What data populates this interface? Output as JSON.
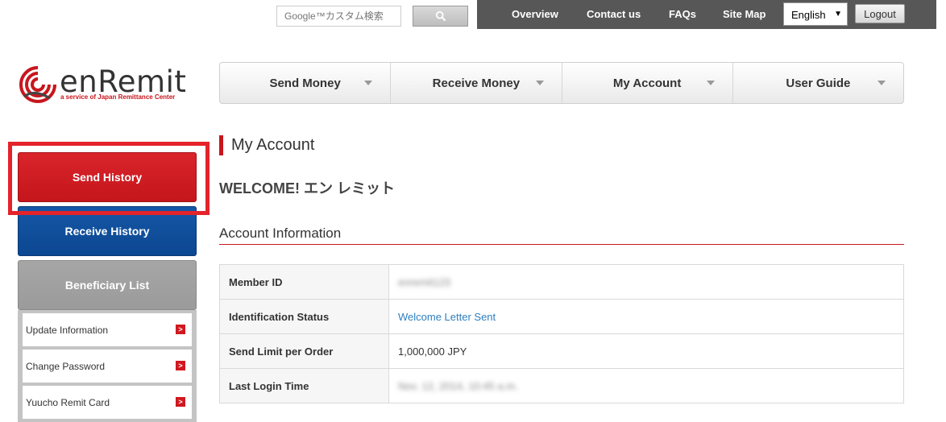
{
  "search": {
    "placeholder": "Google™カスタム検索"
  },
  "topbar": {
    "links": [
      "Overview",
      "Contact us",
      "FAQs",
      "Site Map"
    ],
    "language": "English",
    "logout_label": "Logout"
  },
  "logo": {
    "name": "enRemit",
    "tagline": "a service of Japan Remittance Center"
  },
  "mainnav": {
    "items": [
      "Send Money",
      "Receive Money",
      "My Account",
      "User Guide"
    ]
  },
  "sidebar": {
    "send_history": "Send History",
    "receive_history": "Receive History",
    "beneficiary_list": "Beneficiary List",
    "sub_items": [
      "Update Information",
      "Change Password",
      "Yuucho Remit Card"
    ]
  },
  "content": {
    "page_title": "My Account",
    "welcome": "WELCOME! エン レミット",
    "section_title": "Account Information",
    "rows": [
      {
        "label": "Member ID",
        "value": "enremit123"
      },
      {
        "label": "Identification Status",
        "value": "Welcome Letter Sent"
      },
      {
        "label": "Send Limit per Order",
        "value": "1,000,000 JPY"
      },
      {
        "label": "Last Login Time",
        "value": "Nov. 12, 2014, 10:45 a.m."
      }
    ]
  },
  "colors": {
    "brand_red": "#c8161d",
    "receive_blue": "#0c4791",
    "topbar_gray": "#575757",
    "link_blue": "#2d7fc1"
  }
}
